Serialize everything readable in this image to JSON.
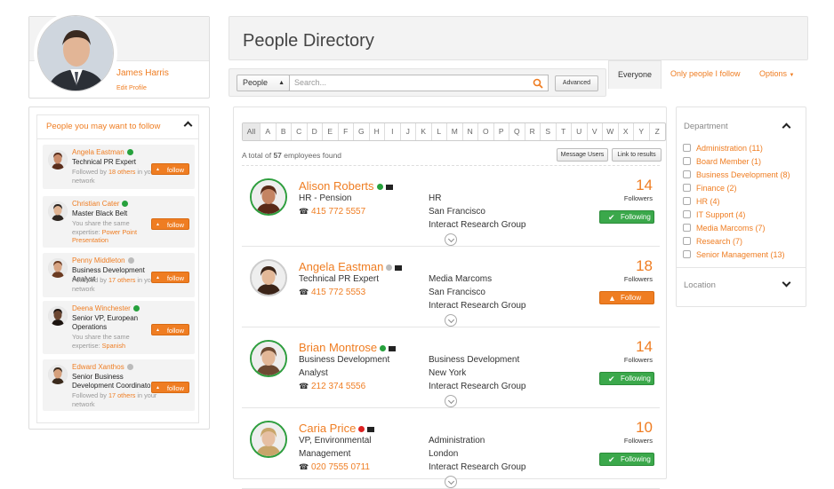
{
  "profile": {
    "name": "James Harris",
    "edit_link": "Edit Profile"
  },
  "suggestions": {
    "title": "People you may want to follow",
    "follow_label": "follow",
    "items": [
      {
        "name": "Angela Eastman",
        "title": "Technical PR Expert",
        "sub": "Followed by ",
        "sub_link": "18 others",
        "sub_tail": " in your network",
        "status": "green"
      },
      {
        "name": "Christian Cater",
        "title": "Master Black Belt",
        "sub": "You share the same expertise: ",
        "sub_link": "Power Point Presentation",
        "sub_tail": "",
        "status": "green"
      },
      {
        "name": "Penny Middleton",
        "title": "Business Development Analyst",
        "sub": "Followed by ",
        "sub_link": "17 others",
        "sub_tail": " in your network",
        "status": "grey"
      },
      {
        "name": "Deena Winchester",
        "title": "Senior VP, European Operations",
        "sub": "You share the same expertise: ",
        "sub_link": "Spanish",
        "sub_tail": "",
        "status": "green"
      },
      {
        "name": "Edward Xanthos",
        "title": "Senior Business Development Coordinator",
        "sub": "Followed by ",
        "sub_link": "17 others",
        "sub_tail": " in your network",
        "status": "grey"
      }
    ]
  },
  "directory": {
    "title": "People Directory",
    "search_scope": "People",
    "search_placeholder": "Search...",
    "advanced_label": "Advanced",
    "tabs": [
      "Everyone",
      "Only people I follow",
      "Options"
    ],
    "alphabet": [
      "All",
      "A",
      "B",
      "C",
      "D",
      "E",
      "F",
      "G",
      "H",
      "I",
      "J",
      "K",
      "L",
      "M",
      "N",
      "O",
      "P",
      "Q",
      "R",
      "S",
      "T",
      "U",
      "V",
      "W",
      "X",
      "Y",
      "Z"
    ],
    "total_prefix": "A total of ",
    "total_count": "57",
    "total_suffix": " employees found",
    "message_users": "Message Users",
    "link_results": "Link to results",
    "followers_label": "Followers",
    "people": [
      {
        "name": "Alison Roberts",
        "title": "HR - Pension",
        "title2": "",
        "phone": "415 772 5557",
        "dept": "HR",
        "city": "San Francisco",
        "group": "Interact Research Group",
        "followers": "14",
        "button": "Following",
        "status": "green"
      },
      {
        "name": "Angela Eastman",
        "title": "Technical PR Expert",
        "title2": "",
        "phone": "415 772 5553",
        "dept": "Media Marcoms",
        "city": "San Francisco",
        "group": "Interact Research Group",
        "followers": "18",
        "button": "Follow",
        "status": "grey"
      },
      {
        "name": "Brian Montrose",
        "title": "Business Development",
        "title2": "Analyst",
        "phone": "212 374 5556",
        "dept": "Business Development",
        "city": "New York",
        "group": "Interact Research Group",
        "followers": "14",
        "button": "Following",
        "status": "green"
      },
      {
        "name": "Caria Price",
        "title": "VP, Environmental",
        "title2": "Management",
        "phone": "020 7555 0711",
        "dept": "Administration",
        "city": "London",
        "group": "Interact Research Group",
        "followers": "10",
        "button": "Following",
        "status": "red"
      }
    ]
  },
  "filters": {
    "department_title": "Department",
    "departments": [
      "Administration (11)",
      "Board Member (1)",
      "Business Development (8)",
      "Finance (2)",
      "HR (4)",
      "IT Support (4)",
      "Media Marcoms (7)",
      "Research (7)",
      "Senior Management (13)"
    ],
    "location_title": "Location"
  },
  "colors": {
    "accent": "#ef7d22",
    "online": "#26a13c",
    "busy": "#dd2222",
    "offline": "#bbbbbb"
  }
}
